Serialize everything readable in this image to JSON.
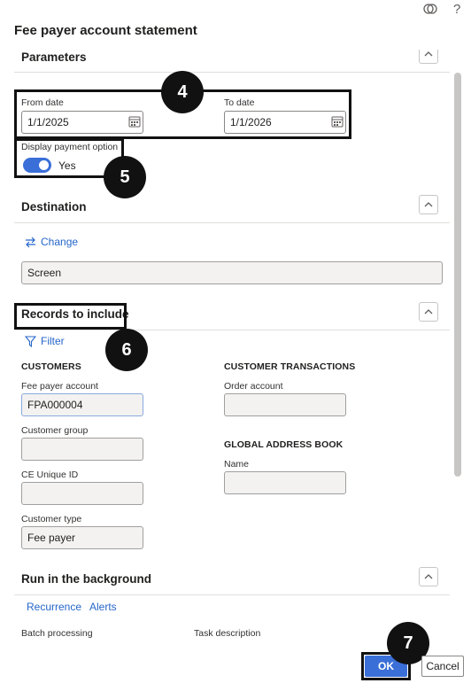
{
  "header": {
    "title": "Fee payer account statement",
    "icons": [
      "microsoft-365-icon",
      "help-icon"
    ],
    "help_glyph": "?"
  },
  "parameters": {
    "title": "Parameters",
    "from_date": {
      "label": "From date",
      "value": "1/1/2025"
    },
    "to_date": {
      "label": "To date",
      "value": "1/1/2026"
    },
    "display_payment": {
      "label": "Display payment option",
      "state": "Yes"
    }
  },
  "destination": {
    "title": "Destination",
    "change_label": "Change",
    "value": "Screen"
  },
  "records": {
    "title": "Records to include",
    "filter_label": "Filter",
    "customers": {
      "heading": "CUSTOMERS",
      "fee_payer_account": {
        "label": "Fee payer account",
        "value": "FPA000004"
      },
      "customer_group": {
        "label": "Customer group",
        "value": ""
      },
      "ce_unique_id": {
        "label": "CE Unique ID",
        "value": ""
      },
      "customer_type": {
        "label": "Customer type",
        "value": "Fee payer"
      }
    },
    "customer_transactions": {
      "heading": "CUSTOMER TRANSACTIONS",
      "order_account": {
        "label": "Order account",
        "value": ""
      }
    },
    "global_address_book": {
      "heading": "GLOBAL ADDRESS BOOK",
      "name": {
        "label": "Name",
        "value": ""
      }
    }
  },
  "background": {
    "title": "Run in the background",
    "recurrence_label": "Recurrence",
    "alerts_label": "Alerts",
    "batch_label": "Batch processing",
    "task_label": "Task description"
  },
  "callouts": [
    "4",
    "5",
    "6",
    "7"
  ],
  "footer": {
    "ok_label": "OK",
    "cancel_label": "Cancel"
  },
  "colors": {
    "accent": "#3a6fd8",
    "link": "#2566c9",
    "callout": "#111111"
  }
}
